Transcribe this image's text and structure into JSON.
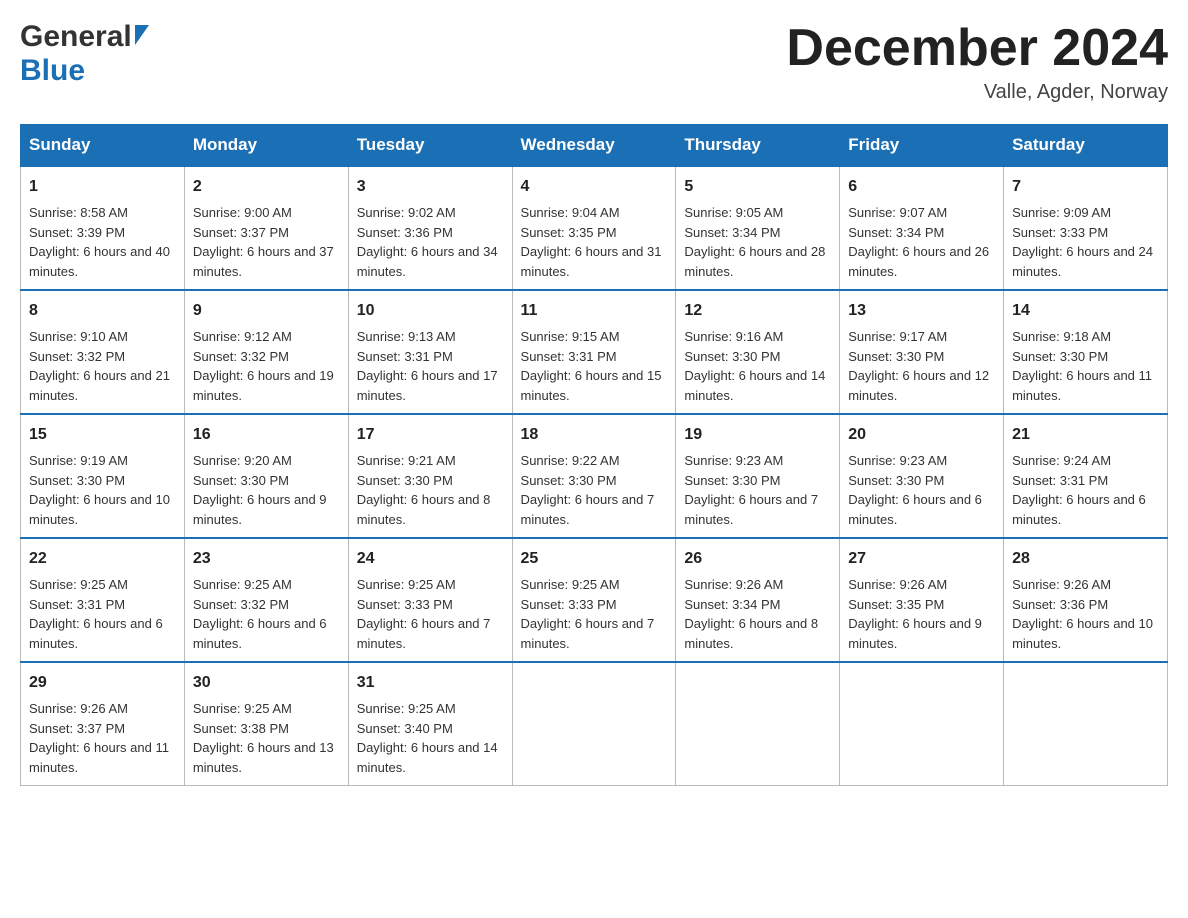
{
  "header": {
    "month_title": "December 2024",
    "location": "Valle, Agder, Norway"
  },
  "days_of_week": [
    "Sunday",
    "Monday",
    "Tuesday",
    "Wednesday",
    "Thursday",
    "Friday",
    "Saturday"
  ],
  "weeks": [
    [
      {
        "day": "1",
        "sunrise": "8:58 AM",
        "sunset": "3:39 PM",
        "daylight": "6 hours and 40 minutes."
      },
      {
        "day": "2",
        "sunrise": "9:00 AM",
        "sunset": "3:37 PM",
        "daylight": "6 hours and 37 minutes."
      },
      {
        "day": "3",
        "sunrise": "9:02 AM",
        "sunset": "3:36 PM",
        "daylight": "6 hours and 34 minutes."
      },
      {
        "day": "4",
        "sunrise": "9:04 AM",
        "sunset": "3:35 PM",
        "daylight": "6 hours and 31 minutes."
      },
      {
        "day": "5",
        "sunrise": "9:05 AM",
        "sunset": "3:34 PM",
        "daylight": "6 hours and 28 minutes."
      },
      {
        "day": "6",
        "sunrise": "9:07 AM",
        "sunset": "3:34 PM",
        "daylight": "6 hours and 26 minutes."
      },
      {
        "day": "7",
        "sunrise": "9:09 AM",
        "sunset": "3:33 PM",
        "daylight": "6 hours and 24 minutes."
      }
    ],
    [
      {
        "day": "8",
        "sunrise": "9:10 AM",
        "sunset": "3:32 PM",
        "daylight": "6 hours and 21 minutes."
      },
      {
        "day": "9",
        "sunrise": "9:12 AM",
        "sunset": "3:32 PM",
        "daylight": "6 hours and 19 minutes."
      },
      {
        "day": "10",
        "sunrise": "9:13 AM",
        "sunset": "3:31 PM",
        "daylight": "6 hours and 17 minutes."
      },
      {
        "day": "11",
        "sunrise": "9:15 AM",
        "sunset": "3:31 PM",
        "daylight": "6 hours and 15 minutes."
      },
      {
        "day": "12",
        "sunrise": "9:16 AM",
        "sunset": "3:30 PM",
        "daylight": "6 hours and 14 minutes."
      },
      {
        "day": "13",
        "sunrise": "9:17 AM",
        "sunset": "3:30 PM",
        "daylight": "6 hours and 12 minutes."
      },
      {
        "day": "14",
        "sunrise": "9:18 AM",
        "sunset": "3:30 PM",
        "daylight": "6 hours and 11 minutes."
      }
    ],
    [
      {
        "day": "15",
        "sunrise": "9:19 AM",
        "sunset": "3:30 PM",
        "daylight": "6 hours and 10 minutes."
      },
      {
        "day": "16",
        "sunrise": "9:20 AM",
        "sunset": "3:30 PM",
        "daylight": "6 hours and 9 minutes."
      },
      {
        "day": "17",
        "sunrise": "9:21 AM",
        "sunset": "3:30 PM",
        "daylight": "6 hours and 8 minutes."
      },
      {
        "day": "18",
        "sunrise": "9:22 AM",
        "sunset": "3:30 PM",
        "daylight": "6 hours and 7 minutes."
      },
      {
        "day": "19",
        "sunrise": "9:23 AM",
        "sunset": "3:30 PM",
        "daylight": "6 hours and 7 minutes."
      },
      {
        "day": "20",
        "sunrise": "9:23 AM",
        "sunset": "3:30 PM",
        "daylight": "6 hours and 6 minutes."
      },
      {
        "day": "21",
        "sunrise": "9:24 AM",
        "sunset": "3:31 PM",
        "daylight": "6 hours and 6 minutes."
      }
    ],
    [
      {
        "day": "22",
        "sunrise": "9:25 AM",
        "sunset": "3:31 PM",
        "daylight": "6 hours and 6 minutes."
      },
      {
        "day": "23",
        "sunrise": "9:25 AM",
        "sunset": "3:32 PM",
        "daylight": "6 hours and 6 minutes."
      },
      {
        "day": "24",
        "sunrise": "9:25 AM",
        "sunset": "3:33 PM",
        "daylight": "6 hours and 7 minutes."
      },
      {
        "day": "25",
        "sunrise": "9:25 AM",
        "sunset": "3:33 PM",
        "daylight": "6 hours and 7 minutes."
      },
      {
        "day": "26",
        "sunrise": "9:26 AM",
        "sunset": "3:34 PM",
        "daylight": "6 hours and 8 minutes."
      },
      {
        "day": "27",
        "sunrise": "9:26 AM",
        "sunset": "3:35 PM",
        "daylight": "6 hours and 9 minutes."
      },
      {
        "day": "28",
        "sunrise": "9:26 AM",
        "sunset": "3:36 PM",
        "daylight": "6 hours and 10 minutes."
      }
    ],
    [
      {
        "day": "29",
        "sunrise": "9:26 AM",
        "sunset": "3:37 PM",
        "daylight": "6 hours and 11 minutes."
      },
      {
        "day": "30",
        "sunrise": "9:25 AM",
        "sunset": "3:38 PM",
        "daylight": "6 hours and 13 minutes."
      },
      {
        "day": "31",
        "sunrise": "9:25 AM",
        "sunset": "3:40 PM",
        "daylight": "6 hours and 14 minutes."
      },
      null,
      null,
      null,
      null
    ]
  ]
}
